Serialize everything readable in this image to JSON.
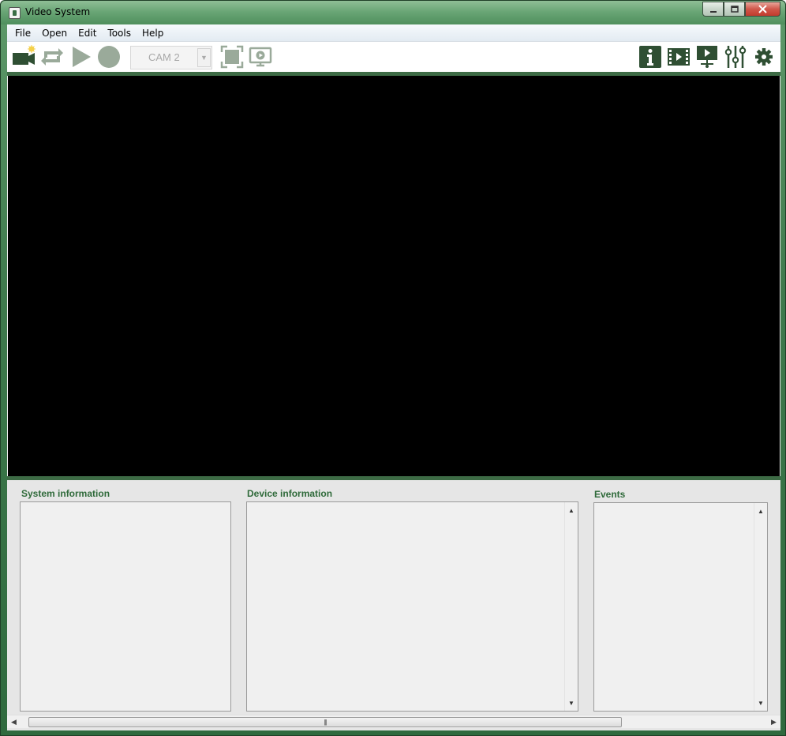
{
  "window": {
    "title": "Video System",
    "controls": [
      "minimize",
      "maximize",
      "close"
    ]
  },
  "menubar": {
    "items": [
      "File",
      "Open",
      "Edit",
      "Tools",
      "Help"
    ]
  },
  "toolbar": {
    "left_icons": [
      "add-camera-icon",
      "refresh-icon",
      "play-icon",
      "record-icon"
    ],
    "camera_select": {
      "value": "CAM 2"
    },
    "mid_icons": [
      "fullscreen-icon",
      "monitor-play-icon"
    ],
    "right_icons": [
      "info-icon",
      "video-film-icon",
      "presentation-icon",
      "sliders-icon",
      "gear-icon"
    ]
  },
  "panels": {
    "system": {
      "label": "System information"
    },
    "device": {
      "label": "Device information"
    },
    "events": {
      "label": "Events"
    }
  },
  "colors": {
    "accent": "#2f5a33",
    "label": "#2f6a3a",
    "disabled": "#9aaa9a"
  }
}
